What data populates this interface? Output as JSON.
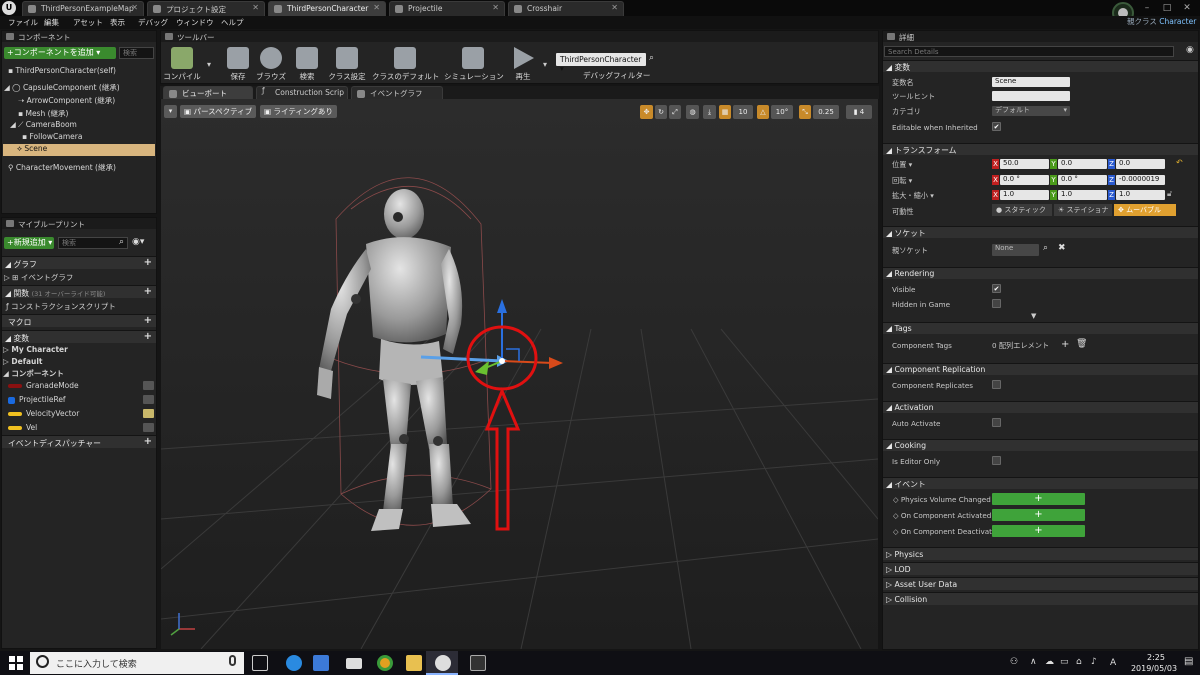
{
  "titlebar": {
    "logo": "U",
    "tabs": [
      "ThirdPersonExampleMap",
      "プロジェクト設定",
      "ThirdPersonCharacter",
      "Projectile",
      "Crosshair"
    ],
    "parent_class_label": "親クラス",
    "parent_class_value": "Character",
    "window_controls": [
      "–",
      "□",
      "✕"
    ]
  },
  "menu": [
    "ファイル",
    "編集",
    "アセット",
    "表示",
    "デバッグ",
    "ウィンドウ",
    "ヘルプ"
  ],
  "components": {
    "panel_title": "コンポーネント",
    "add_button": "+コンポーネントを追加 ▾",
    "search_placeholder": "検索",
    "self": "ThirdPersonCharacter(self)",
    "items": [
      "CapsuleComponent (継承)",
      "ArrowComponent (継承)",
      "Mesh (継承)",
      "CameraBoom",
      "FollowCamera",
      "Scene",
      "CharacterMovement (継承)"
    ]
  },
  "blueprint": {
    "panel_title": "マイブループリント",
    "add_button": "+新規追加 ▾",
    "search_placeholder": "検索",
    "sections": {
      "graph": "グラフ",
      "event_graph": "イベントグラフ",
      "functions": "関数",
      "functions_note": "(31 オーバーライド可能)",
      "construction_script": "コンストラクションスクリプト",
      "macros": "マクロ",
      "variables": "変数",
      "event_dispatchers": "イベントディスパッチャー"
    },
    "var_categories": [
      "My Character",
      "Default",
      "コンポーネント"
    ],
    "variables": [
      {
        "name": "GranadeMode",
        "color": "#8a1010"
      },
      {
        "name": "ProjectileRef",
        "color": "#1a6ae0"
      },
      {
        "name": "VelocityVector",
        "color": "#f0c020"
      },
      {
        "name": "Vel",
        "color": "#f0c020"
      }
    ]
  },
  "toolbar": {
    "panel_title": "ツールバー",
    "buttons": [
      "コンパイル",
      "保存",
      "ブラウズ",
      "検索",
      "クラス設定",
      "クラスのデフォルト",
      "シミュレーション",
      "再生"
    ],
    "debug_object": "ThirdPersonCharacter",
    "debug_filter_label": "デバッグフィルター"
  },
  "editor_tabs": [
    "ビューポート",
    "Construction Scrip",
    "イベントグラフ"
  ],
  "viewport": {
    "perspective": "パースペクティブ",
    "lighting": "ライティングあり",
    "grid_snap": "10",
    "rotation_snap": "10°",
    "scale_snap": "0.25",
    "camera_speed": "4"
  },
  "details": {
    "panel_title": "詳細",
    "search_placeholder": "Search Details",
    "variable": {
      "header": "変数",
      "name_label": "変数名",
      "name_value": "Scene",
      "tooltip_label": "ツールヒント",
      "tooltip_value": "",
      "category_label": "カテゴリ",
      "category_value": "デフォルト",
      "editable_label": "Editable when Inherited",
      "editable_checked": true
    },
    "transform": {
      "header": "トランスフォーム",
      "location_label": "位置 ▾",
      "location": [
        "50.0",
        "0.0",
        "0.0"
      ],
      "rotation_label": "回転 ▾",
      "rotation": [
        "0.0 °",
        "0.0 °",
        "-0.0000019"
      ],
      "scale_label": "拡大・縮小 ▾",
      "scale": [
        "1.0",
        "1.0",
        "1.0"
      ],
      "mobility_label": "可動性",
      "mobility_options": [
        "スタティック",
        "ステイショナ",
        "ムーバブル"
      ],
      "mobility_selected": "ムーバブル"
    },
    "socket": {
      "header": "ソケット",
      "parent_socket_label": "親ソケット",
      "parent_socket_value": "None"
    },
    "rendering": {
      "header": "Rendering",
      "visible_label": "Visible",
      "visible_checked": true,
      "hidden_label": "Hidden in Game",
      "hidden_checked": false
    },
    "tags": {
      "header": "Tags",
      "component_tags_label": "Component Tags",
      "component_tags_value": "0 配列エレメント"
    },
    "replication": {
      "header": "Component Replication",
      "label": "Component Replicates",
      "checked": false
    },
    "activation": {
      "header": "Activation",
      "label": "Auto Activate",
      "checked": false
    },
    "cooking": {
      "header": "Cooking",
      "label": "Is Editor Only",
      "checked": false
    },
    "events": {
      "header": "イベント",
      "items": [
        "Physics Volume Changed",
        "On Component Activated",
        "On Component Deactivate"
      ]
    },
    "collapsed_sections": [
      "Physics",
      "LOD",
      "Asset User Data",
      "Collision"
    ]
  },
  "taskbar": {
    "search_placeholder": "ここに入力して検索",
    "time": "2:25",
    "date": "2019/05/03",
    "ime": "A"
  },
  "colors": {
    "accent_green": "#3a8a2e",
    "selection": "#d8b57e",
    "annotation_red": "#e01010",
    "snap_orange": "#c88a2a"
  }
}
